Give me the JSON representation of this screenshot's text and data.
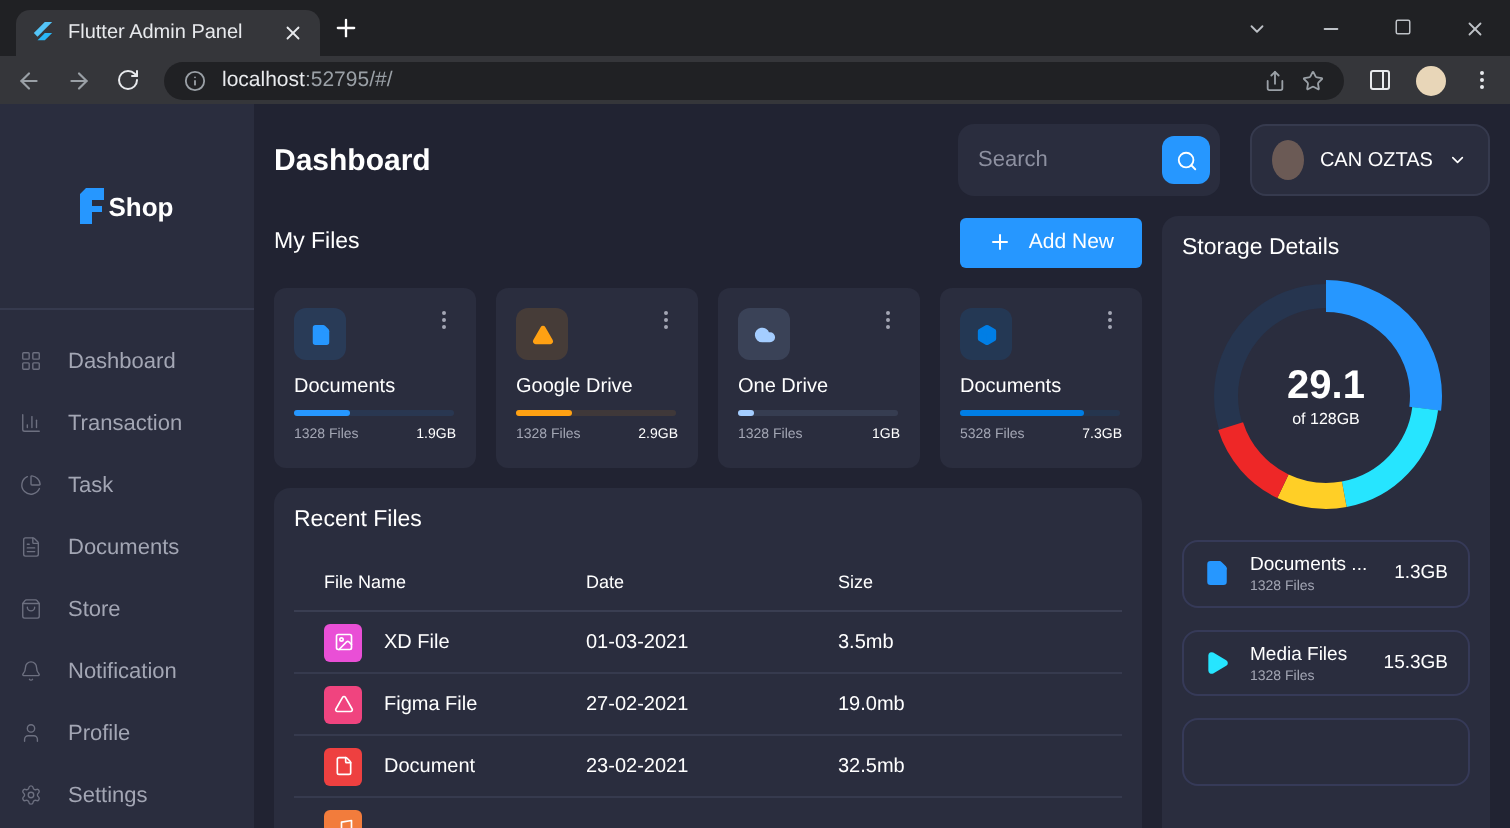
{
  "browser": {
    "tab_title": "Flutter Admin Panel",
    "url_host": "localhost",
    "url_rest": ":52795/#/"
  },
  "sidebar": {
    "logo": "Shop",
    "items": [
      "Dashboard",
      "Transaction",
      "Task",
      "Documents",
      "Store",
      "Notification",
      "Profile",
      "Settings"
    ]
  },
  "header": {
    "title": "Dashboard",
    "search": {
      "placeholder": "Search"
    },
    "profile": {
      "name": "CAN OZTAS"
    }
  },
  "my_files": {
    "title": "My Files",
    "add_button": "Add New",
    "cards": [
      {
        "title": "Documents",
        "files": "1328 Files",
        "size": "1.9GB",
        "level": 0.35,
        "color": "#2697ff"
      },
      {
        "title": "Google Drive",
        "files": "1328 Files",
        "size": "2.9GB",
        "level": 0.35,
        "color": "#ffa113"
      },
      {
        "title": "One Drive",
        "files": "1328 Files",
        "size": "1GB",
        "level": 0.1,
        "color": "#a4cdff"
      },
      {
        "title": "Documents",
        "files": "5328 Files",
        "size": "7.3GB",
        "level": 0.78,
        "color": "#007ee5"
      }
    ]
  },
  "recent_files": {
    "title": "Recent Files",
    "columns": [
      "File Name",
      "Date",
      "Size"
    ],
    "rows": [
      {
        "name": "XD File",
        "date": "01-03-2021",
        "size": "3.5mb",
        "color": "#e94fd6"
      },
      {
        "name": "Figma File",
        "date": "27-02-2021",
        "size": "19.0mb",
        "color": "#f0447f"
      },
      {
        "name": "Document",
        "date": "23-02-2021",
        "size": "32.5mb",
        "color": "#ee4040"
      },
      {
        "color": "#f27c3c"
      }
    ]
  },
  "storage": {
    "title": "Storage Details",
    "total": "29.1",
    "caption": "of 128GB",
    "items": [
      {
        "title": "Documents ...",
        "files": "1328 Files",
        "size": "1.3GB",
        "color": "#2697ff"
      },
      {
        "title": "Media Files",
        "files": "1328 Files",
        "size": "15.3GB",
        "color": "#26e5ff"
      }
    ]
  }
}
